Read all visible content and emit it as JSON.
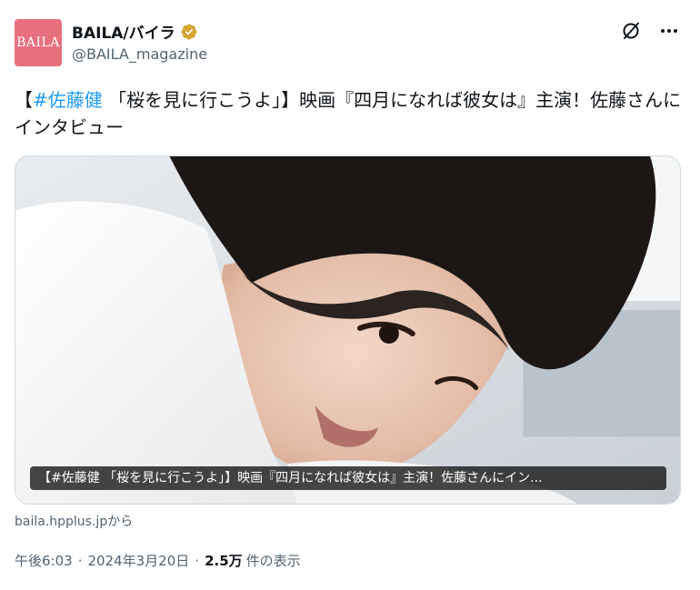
{
  "author": {
    "avatar_text": "BAILA",
    "display_name": "BAILA/バイラ",
    "handle": "@BAILA_magazine",
    "verified": true,
    "verified_color": "#d6a735"
  },
  "actions": {
    "grok_icon": "grok-icon",
    "more_icon": "more-icon"
  },
  "tweet": {
    "open_bracket": "【",
    "hashtag": "#佐藤健",
    "text_rest": " 「桜を見に行こうよ」】映画『四月になれば彼女は』主演！佐藤さんにインタビュー"
  },
  "card": {
    "caption": "【#佐藤健 「桜を見に行こうよ」】映画『四月になれば彼女は』主演！佐藤さんにイン...",
    "source": "baila.hpplus.jpから"
  },
  "meta": {
    "time": "午後6:03",
    "separator": "·",
    "date": "2024年3月20日",
    "views_count": "2.5万",
    "views_label": "件の表示"
  },
  "colors": {
    "hashtag": "#1d9bf0",
    "avatar_bg": "#e8707f",
    "secondary_text": "#536471"
  }
}
